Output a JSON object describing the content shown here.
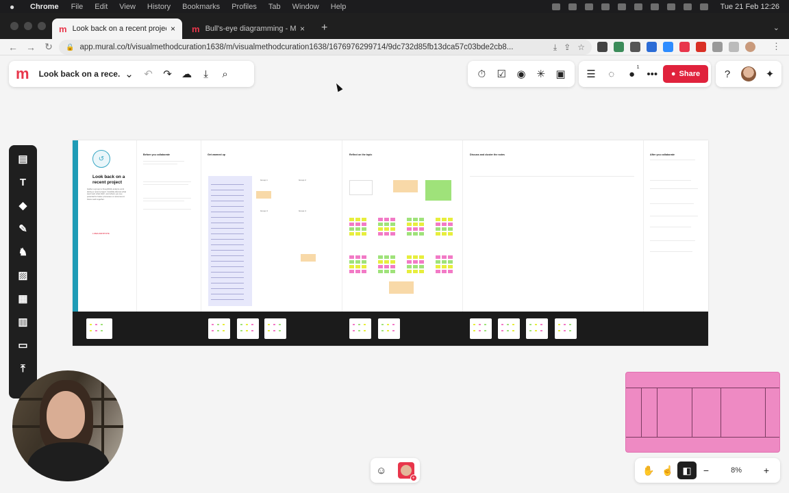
{
  "os_menubar": {
    "app": "Chrome",
    "items": [
      "File",
      "Edit",
      "View",
      "History",
      "Bookmarks",
      "Profiles",
      "Tab",
      "Window",
      "Help"
    ],
    "clock": "Tue 21 Feb  12:26"
  },
  "browser": {
    "tabs": [
      {
        "title": "Look back on a recent project",
        "active": true
      },
      {
        "title": "Bull's-eye diagramming - Mura",
        "active": false
      }
    ],
    "url": "app.mural.co/t/visualmethodcuration1638/m/visualmethodcuration1638/1676976299714/9dc732d85fb13dca57c03bde2cb8..."
  },
  "mural": {
    "title": "Look back on a rece...",
    "share_label": "Share",
    "zoom_level": "8%",
    "collaborator_badge": "1"
  },
  "board": {
    "intro": {
      "title": "Look back on a recent project",
      "description": "Gather a group to thoughtfully analyze work during a recent project. Candidly discuss what went well, what didn't, and where you see potential for better processes or outcomes in future work together.",
      "brand": "LUMA INSTITUTE"
    },
    "sections": [
      {
        "title": "Before you collaborate"
      },
      {
        "title": "Get warmed up"
      },
      {
        "title": "Reflect on the topic"
      },
      {
        "title": "Discuss and cluster the notes"
      },
      {
        "title": "After you collaborate"
      }
    ],
    "group_labels": [
      "Group 1",
      "Group 2",
      "Group 3",
      "Group 4"
    ]
  },
  "icons": {
    "undo": "undo-icon",
    "redo": "redo-icon",
    "save": "cloud-save-icon",
    "download": "download-icon",
    "search": "search-icon"
  },
  "colors": {
    "mural_red": "#e8364b",
    "share_red": "#e0223c",
    "stripe_teal": "#1e9bb6",
    "minimap_pink": "#ee8ac3",
    "sticky_yellow": "#e7ee3c",
    "sticky_pink": "#f27ac6",
    "sticky_green": "#9fe27a"
  }
}
